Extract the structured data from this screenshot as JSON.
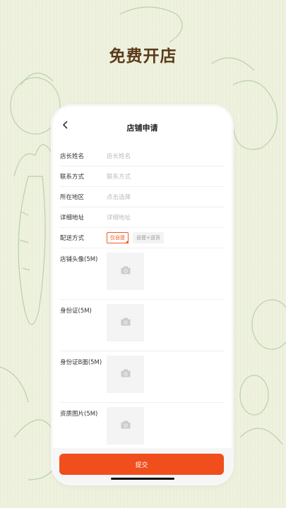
{
  "headline": "免费开店",
  "nav": {
    "title": "店铺申请",
    "back_icon": "chevron-left-icon"
  },
  "form": {
    "owner_name": {
      "label": "店长姓名",
      "placeholder": "店长姓名"
    },
    "contact": {
      "label": "联系方式",
      "placeholder": "联系方式"
    },
    "region": {
      "label": "所在地区",
      "placeholder": "点击选择"
    },
    "address": {
      "label": "详细地址",
      "placeholder": "详细地址"
    },
    "delivery": {
      "label": "配送方式",
      "options": [
        "仅自提",
        "自提+送货"
      ],
      "selected": "仅自提"
    },
    "uploads": [
      {
        "label": "店铺头像(5M)"
      },
      {
        "label": "身份证(5M)"
      },
      {
        "label": "身份证B面(5M)"
      },
      {
        "label": "资质图片(5M)"
      }
    ]
  },
  "submit_label": "提交",
  "colors": {
    "accent": "#f04e1c",
    "headline": "#5b3a1a",
    "background": "#edf1dd"
  }
}
